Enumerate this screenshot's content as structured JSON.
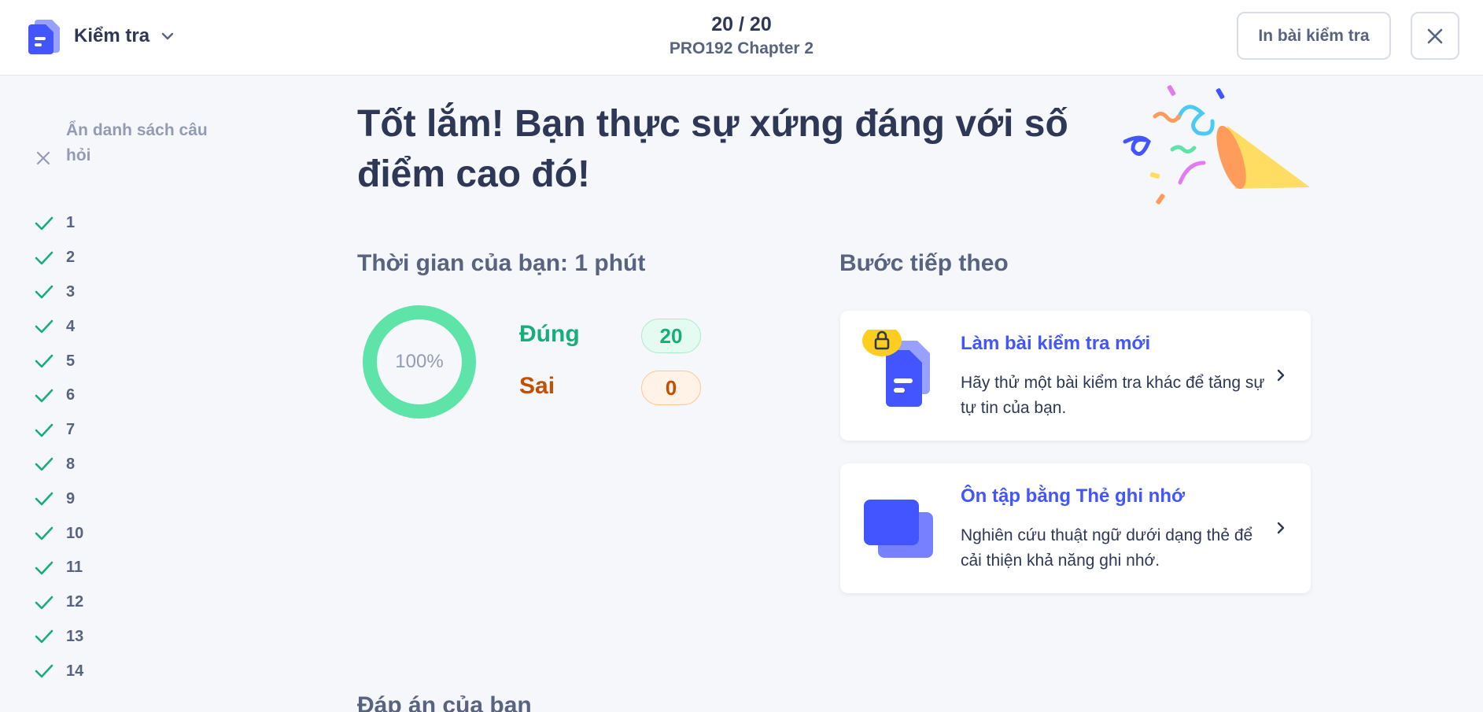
{
  "header": {
    "mode_label": "Kiểm tra",
    "progress": "20 / 20",
    "set_title": "PRO192 Chapter 2",
    "print_label": "In bài kiểm tra"
  },
  "sidebar": {
    "hide_label": "Ẩn danh sách câu hỏi",
    "questions": [
      "1",
      "2",
      "3",
      "4",
      "5",
      "6",
      "7",
      "8",
      "9",
      "10",
      "11",
      "12",
      "13",
      "14"
    ]
  },
  "main": {
    "headline": "Tốt lắm! Bạn thực sự xứng đáng với số điểm cao đó!",
    "time_title": "Thời gian của bạn: 1 phút",
    "score_percent": "100%",
    "correct_label": "Đúng",
    "correct_count": "20",
    "wrong_label": "Sai",
    "wrong_count": "0",
    "next_title": "Bước tiếp theo",
    "answers_title": "Đáp án của bạn"
  },
  "next_steps": [
    {
      "title": "Làm bài kiểm tra mới",
      "desc": "Hãy thử một bài kiểm tra khác để tăng sự tự tin của bạn.",
      "icon": "locked-test-icon"
    },
    {
      "title": "Ôn tập bằng Thẻ ghi nhớ",
      "desc": "Nghiên cứu thuật ngữ dưới dạng thẻ để cải thiện khả năng ghi nhớ.",
      "icon": "flashcards-icon"
    }
  ],
  "colors": {
    "accent": "#4255ff",
    "correct": "#18ae79",
    "wrong": "#c34f00",
    "ring": "#5ee3a8"
  }
}
